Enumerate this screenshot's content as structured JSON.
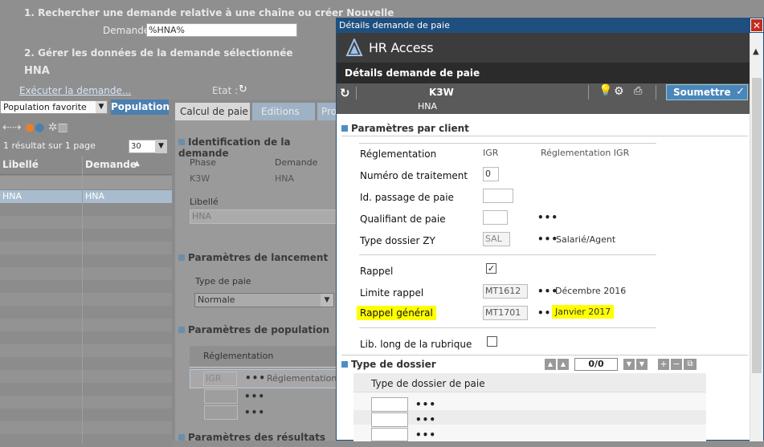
{
  "bg": {
    "step1": "1. Rechercher une demande relative à une chaîne ou créer Nouvelle",
    "demande_label": "Demande",
    "demande_value": "%HNA%",
    "step2": "2. Gérer les données de la demande sélectionnée",
    "hna": "HNA",
    "execute_link": "Exécuter la demande...",
    "etat_label": "Etat :",
    "population_select": "Population favorite",
    "population_btn": "Population",
    "page_size": "30",
    "result_text": "1 résultat sur 1 page",
    "col_libelle": "Libellé",
    "col_demande": "Demande",
    "row_libelle": "HNA",
    "row_demande": "HNA",
    "tabs": [
      "Calcul de paie",
      "Editions",
      "Pro"
    ],
    "identification_title": "Identification de la demande",
    "phase_label": "Phase",
    "phase_value": "K3W",
    "demande2_label": "Demande",
    "demande2_value": "HNA",
    "libelle_label": "Libellé",
    "libelle_value": "HNA",
    "lancement_title": "Paramètres de lancement",
    "type_paie_label": "Type de paie",
    "type_paie_value": "Normale",
    "population_title": "Paramètres de population",
    "reglementation_header": "Réglementation",
    "igr_value": "IGR",
    "reglementation_cut": "Réglementation",
    "resultats_title": "Paramètres des résultats"
  },
  "modal": {
    "title": "Détails demande de paie",
    "brand": "HR Access",
    "header_title": "Détails demande de paie",
    "k3w": "K3W",
    "hna": "HNA",
    "submit_label": "Soumettre",
    "section1_title": "Paramètres par client",
    "fields": {
      "reglementation_label": "Réglementation",
      "reglementation_code": "IGR",
      "reglementation_desc": "Réglementation IGR",
      "num_traitement_label": "Numéro de traitement",
      "num_traitement_value": "0",
      "id_passage_label": "Id. passage de paie",
      "qualifiant_label": "Qualifiant de paie",
      "type_dossier_label": "Type dossier ZY",
      "type_dossier_value": "SAL",
      "type_dossier_desc": "Salarié/Agent",
      "rappel_label": "Rappel",
      "limite_rappel_label": "Limite rappel",
      "limite_rappel_value": "MT1612",
      "limite_rappel_desc": "Décembre 2016",
      "rappel_general_label": "Rappel général",
      "rappel_general_value": "MT1701",
      "rappel_general_desc": "Janvier 2017",
      "lib_long_label": "Lib. long de la rubrique",
      "dots": "•••"
    },
    "section2_title": "Type de dossier",
    "pager_value": "0/0",
    "table_header": "Type de dossier de paie",
    "colors": {
      "accent": "#4d8ec9",
      "highlight": "#ffff00",
      "titlebar": "#1f4f7e",
      "dark": "#3f3f3f"
    }
  }
}
